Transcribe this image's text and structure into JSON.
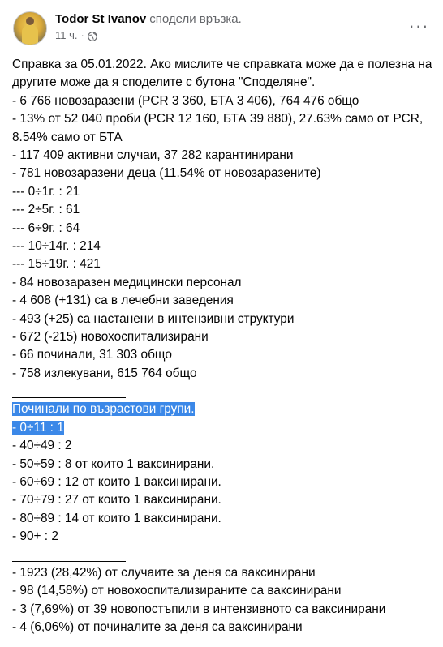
{
  "post": {
    "author": "Todor St Ivanov",
    "action": "сподели връзка.",
    "time": "11 ч.",
    "dot": "·",
    "more_label": "···"
  },
  "intro": [
    "Справка за 05.01.2022. Ако мислите че справката може да е полезна на другите може да я споделите с бутона \"Споделяне\"."
  ],
  "stats": [
    "- 6 766 новозаразени (PCR 3 360, БТА 3 406), 764 476 общо",
    "- 13% от 52 040 проби (PCR 12 160, БТА 39 880), 27.63% само от PCR, 8.54% само от БТА",
    "- 117 409 активни случаи, 37 282 карантинирани",
    "- 781 новозаразени деца (11.54% от новозаразените)",
    "--- 0÷1г. : 21",
    "--- 2÷5г. : 61",
    "--- 6÷9г. : 64",
    "--- 10÷14г. : 214",
    "--- 15÷19г. : 421",
    "- 84 новозаразен медицински персонал",
    "- 4 608 (+131) са в лечебни заведения",
    "- 493 (+25) са настанени в интензивни структури",
    "- 672 (-215) новохоспитализирани",
    "- 66 починали, 31 303 общо",
    "- 758 излекувани, 615 764 общо"
  ],
  "deaths_header": "Починали по възрастови групи.",
  "deaths_first": "- 0÷11 : 1",
  "deaths": [
    "- 40÷49 : 2",
    "- 50÷59 : 8 от които 1 ваксинирани.",
    "- 60÷69 : 12 от които 1 ваксинирани.",
    "- 70÷79 : 27 от които 1 ваксинирани.",
    "- 80÷89 : 14 от които 1 ваксинирани.",
    "- 90+ : 2"
  ],
  "vaccinated": [
    "- 1923 (28,42%) от случаите за деня са ваксинирани",
    "- 98 (14,58%) от новохоспитализираните са ваксинирани",
    "- 3 (7,69%) от 39 новопостъпили в интензивното са ваксинирани",
    "- 4 (6,06%) от починалите за деня са ваксинирани"
  ]
}
